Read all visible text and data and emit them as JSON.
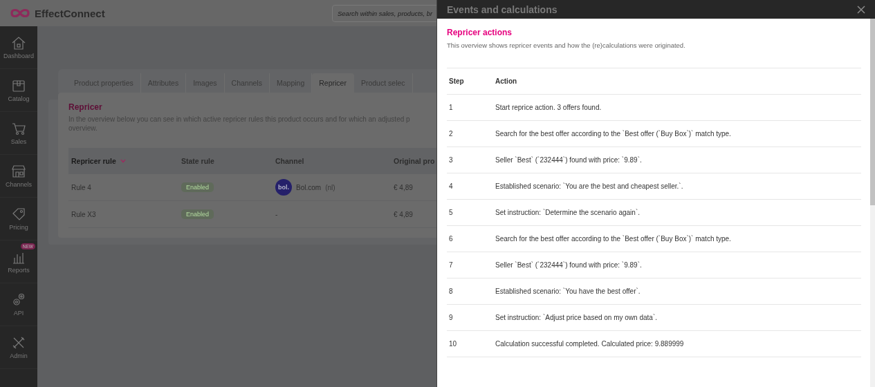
{
  "app": {
    "logo": "EffectConnect",
    "search": {
      "placeholder": "Search within sales, products, br"
    }
  },
  "sidebar": {
    "items": [
      {
        "label": "Dashboard"
      },
      {
        "label": "Catalog"
      },
      {
        "label": "Sales"
      },
      {
        "label": "Channels"
      },
      {
        "label": "Pricing"
      },
      {
        "label": "Reports",
        "badge": "NEW"
      },
      {
        "label": "API"
      },
      {
        "label": "Admin"
      }
    ]
  },
  "tabs": [
    {
      "label": "Product properties",
      "selected": false
    },
    {
      "label": "Attributes",
      "selected": false
    },
    {
      "label": "Images",
      "selected": false
    },
    {
      "label": "Channels",
      "selected": false
    },
    {
      "label": "Mapping",
      "selected": false
    },
    {
      "label": "Repricer",
      "selected": true
    },
    {
      "label": "Product selec",
      "selected": false
    }
  ],
  "repricer_card": {
    "title": "Repricer",
    "description_lines": [
      "In the overview below you can see in which active repricer rules this product occurs and for which an adjusted p",
      "overview."
    ],
    "table": {
      "columns": [
        {
          "label": "Repricer rule",
          "sorted": true
        },
        {
          "label": "State rule",
          "sorted": false
        },
        {
          "label": "Channel",
          "sorted": false
        },
        {
          "label": "Original pro",
          "sorted": false
        }
      ],
      "rows": [
        {
          "rule": "Rule 4",
          "state": "Enabled",
          "channel": {
            "kind": "marketplace",
            "logo": "bol.",
            "name": "Bol.com",
            "locale": "(nl)"
          },
          "original_price": "€ 4,89"
        },
        {
          "rule": "Rule X3",
          "state": "Enabled",
          "channel": {
            "kind": "none",
            "text": "-"
          },
          "original_price": "€ 4,89"
        }
      ]
    }
  },
  "drawer": {
    "title": "Events and calculations",
    "section_title": "Repricer actions",
    "description": "This overview shows repricer events and how the (re)calculations were originated.",
    "columns": [
      "Step",
      "Action"
    ],
    "rows": [
      {
        "step": "1",
        "action": "Start reprice action. 3 offers found."
      },
      {
        "step": "2",
        "action": "Search for the best offer according to the `Best offer (`Buy Box`)` match type."
      },
      {
        "step": "3",
        "action": "Seller `Best` (`232444`) found with price: `9.89`."
      },
      {
        "step": "4",
        "action": "Established scenario: `You are the best and cheapest seller.`."
      },
      {
        "step": "5",
        "action": "Set instruction: `Determine the scenario again`."
      },
      {
        "step": "6",
        "action": "Search for the best offer according to the `Best offer (`Buy Box`)` match type."
      },
      {
        "step": "7",
        "action": "Seller `Best` (`232444`) found with price: `9.89`."
      },
      {
        "step": "8",
        "action": "Established scenario: `You have the best offer`."
      },
      {
        "step": "9",
        "action": "Set instruction: `Adjust price based on my own data`."
      },
      {
        "step": "10",
        "action": "Calculation successful completed. Calculated price: 9.889999"
      }
    ]
  }
}
